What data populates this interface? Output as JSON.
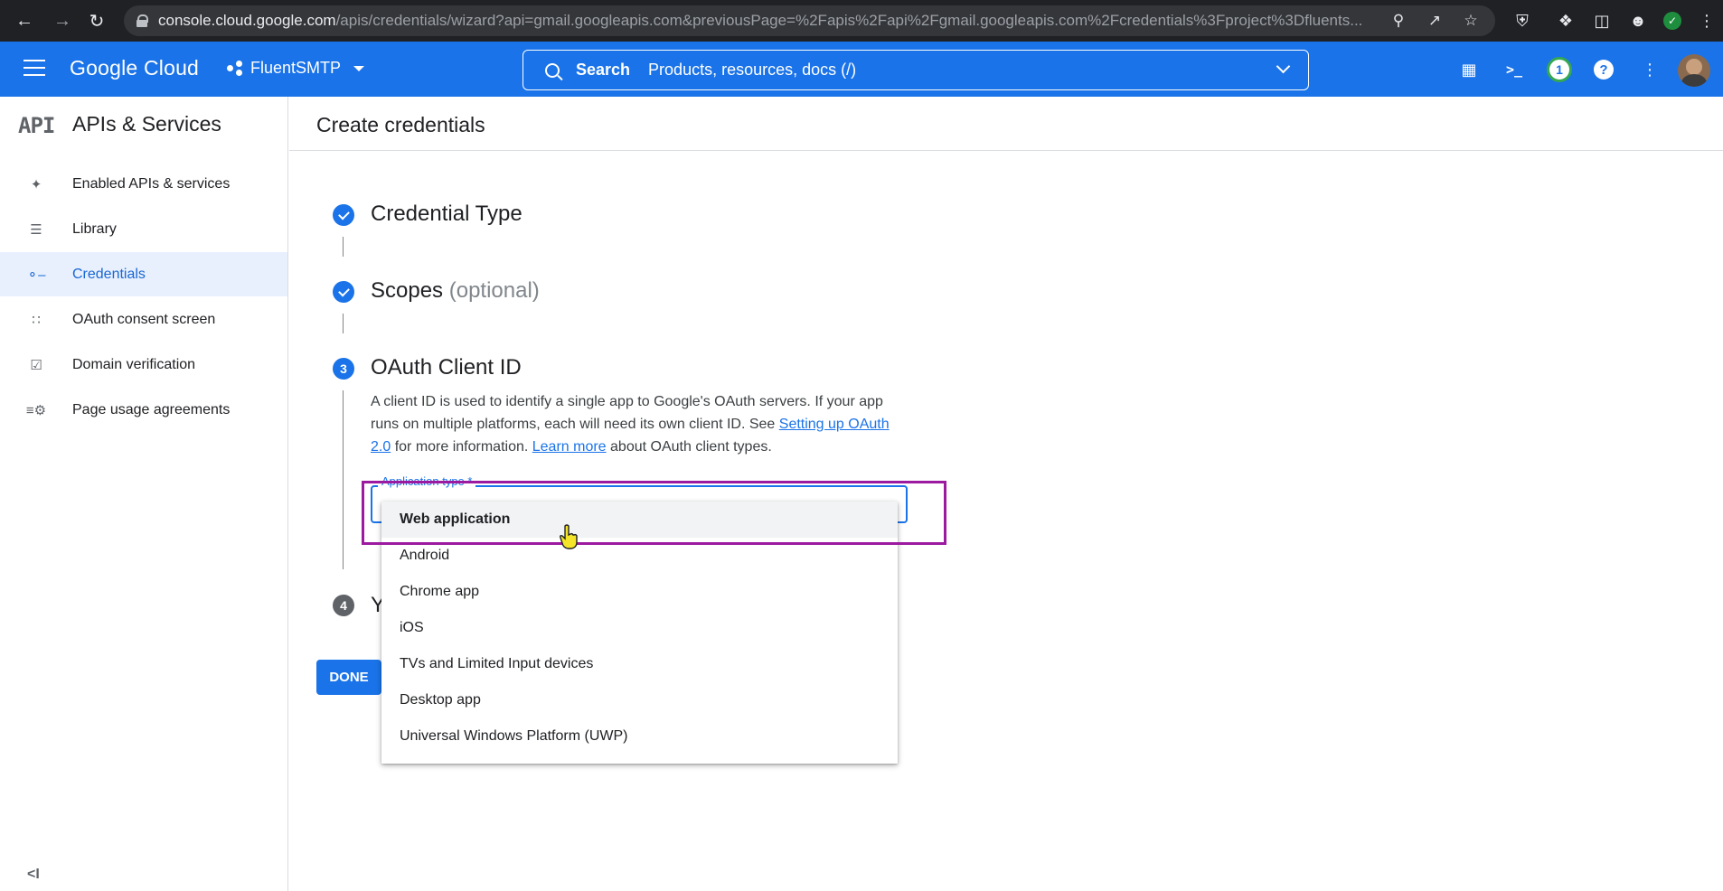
{
  "browser": {
    "url_host": "console.cloud.google.com",
    "url_path": "/apis/credentials/wizard?api=gmail.googleapis.com&previousPage=%2Fapis%2Fapi%2Fgmail.googleapis.com%2Fcredentials%3Fproject%3Dfluents..."
  },
  "topbar": {
    "logo": "Google Cloud",
    "project": "FluentSMTP",
    "search_label": "Search",
    "search_placeholder": "Products, resources, docs (/)",
    "notification_count": "1",
    "help_glyph": "?"
  },
  "sidebar": {
    "logo_text": "API",
    "title": "APIs & Services",
    "items": [
      {
        "label": "Enabled APIs & services",
        "icon": "enabled-apis-icon",
        "active": false
      },
      {
        "label": "Library",
        "icon": "library-icon",
        "active": false
      },
      {
        "label": "Credentials",
        "icon": "key-icon",
        "active": true
      },
      {
        "label": "OAuth consent screen",
        "icon": "oauth-consent-icon",
        "active": false
      },
      {
        "label": "Domain verification",
        "icon": "domain-verification-icon",
        "active": false
      },
      {
        "label": "Page usage agreements",
        "icon": "page-usage-icon",
        "active": false
      }
    ],
    "collapse_glyph": "<I"
  },
  "main": {
    "page_title": "Create credentials",
    "steps": [
      {
        "title": "Credential Type",
        "suffix": "",
        "state": "done"
      },
      {
        "title": "Scopes",
        "suffix": "(optional)",
        "state": "done"
      },
      {
        "number": "3",
        "title": "OAuth Client ID",
        "state": "active"
      },
      {
        "number": "4",
        "title": "Y",
        "state": "pending"
      }
    ],
    "description": {
      "part1": "A client ID is used to identify a single app to Google's OAuth servers. If your app runs on multiple platforms, each will need its own client ID. See ",
      "link1": "Setting up OAuth 2.0",
      "part2": " for more information. ",
      "link2": "Learn more",
      "part3": " about OAuth client types."
    },
    "application_type_label": "Application type *",
    "dropdown_options": [
      "Web application",
      "Android",
      "Chrome app",
      "iOS",
      "TVs and Limited Input devices",
      "Desktop app",
      "Universal Windows Platform (UWP)"
    ],
    "hovered_option": "Web application",
    "done_button": "DONE"
  },
  "colors": {
    "brand_blue": "#1a73e8",
    "highlight_purple": "#9c1aa0",
    "active_nav_bg": "#e8f0fe"
  }
}
